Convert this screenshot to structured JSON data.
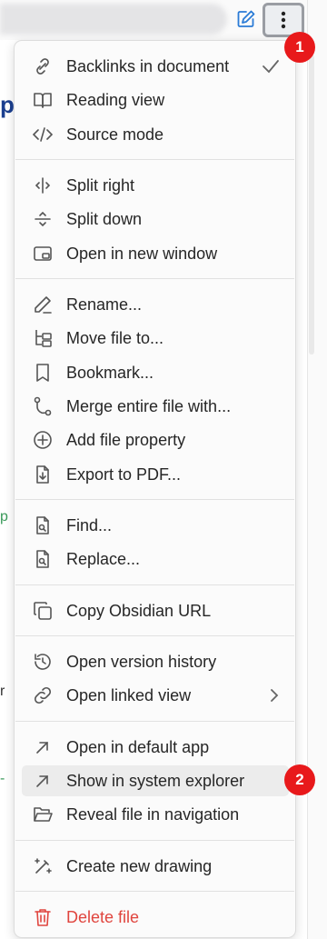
{
  "header": {
    "more_options_icon": "vertical-dots-icon",
    "edit_icon": "edit-icon"
  },
  "background_fragments": [
    "p",
    "p",
    "r",
    "-"
  ],
  "menu": {
    "items": [
      {
        "label": "Backlinks in document",
        "icon": "backlinks-icon",
        "checked": true
      },
      {
        "label": "Reading view",
        "icon": "book-open-icon"
      },
      {
        "label": "Source mode",
        "icon": "code-icon"
      },
      {
        "label": "Split right",
        "icon": "split-right-icon"
      },
      {
        "label": "Split down",
        "icon": "split-down-icon"
      },
      {
        "label": "Open in new window",
        "icon": "new-window-icon"
      },
      {
        "label": "Rename...",
        "icon": "pencil-icon"
      },
      {
        "label": "Move file to...",
        "icon": "folder-tree-icon"
      },
      {
        "label": "Bookmark...",
        "icon": "bookmark-icon"
      },
      {
        "label": "Merge entire file with...",
        "icon": "git-merge-icon"
      },
      {
        "label": "Add file property",
        "icon": "plus-circle-icon"
      },
      {
        "label": "Export to PDF...",
        "icon": "file-download-icon"
      },
      {
        "label": "Find...",
        "icon": "file-search-icon"
      },
      {
        "label": "Replace...",
        "icon": "file-replace-icon"
      },
      {
        "label": "Copy Obsidian URL",
        "icon": "copy-icon"
      },
      {
        "label": "Open version history",
        "icon": "history-icon"
      },
      {
        "label": "Open linked view",
        "icon": "link-icon",
        "submenu": true
      },
      {
        "label": "Open in default app",
        "icon": "arrow-up-right-icon"
      },
      {
        "label": "Show in system explorer",
        "icon": "arrow-up-right-icon",
        "highlighted": true
      },
      {
        "label": "Reveal file in navigation",
        "icon": "folder-open-icon"
      },
      {
        "label": "Create new drawing",
        "icon": "magic-wand-icon"
      },
      {
        "label": "Delete file",
        "icon": "trash-icon",
        "danger": true
      }
    ]
  },
  "annotations": {
    "badge_1": "1",
    "badge_2": "2"
  },
  "colors": {
    "accent": "#2a7bd6",
    "danger": "#e0453e",
    "badge": "#e8191b"
  }
}
